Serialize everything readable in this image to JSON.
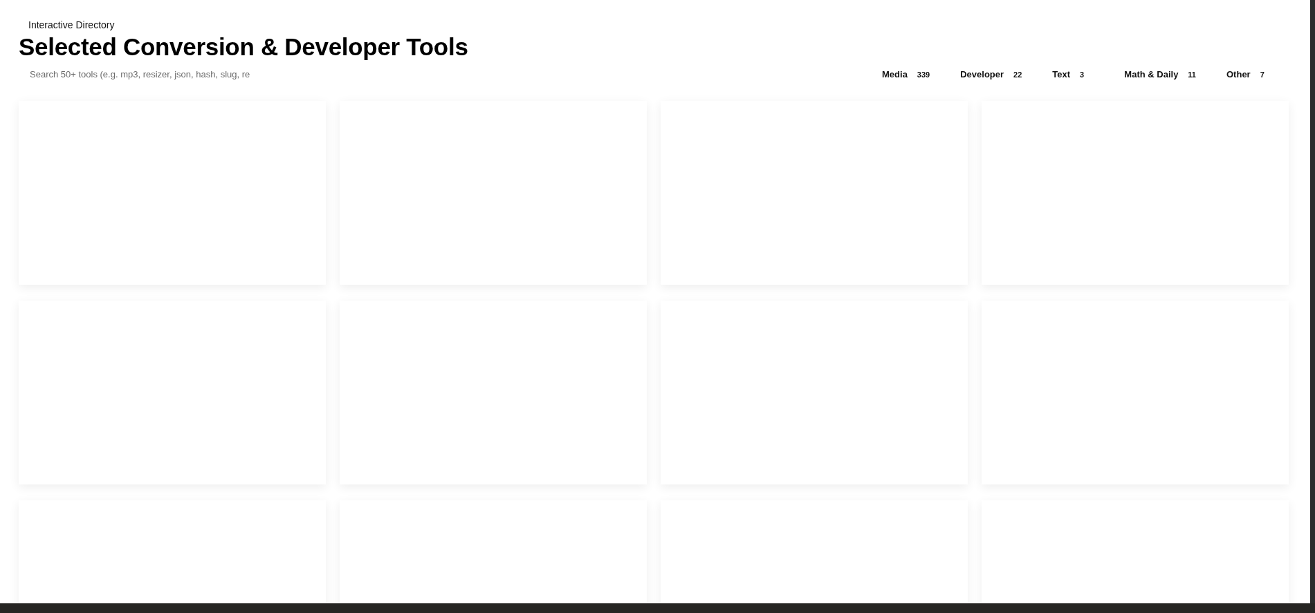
{
  "eyebrow": "Interactive Directory",
  "title": "Selected Conversion & Developer Tools",
  "search": {
    "placeholder": "Search 50+ tools (e.g. mp3, resizer, json, hash, slug, re"
  },
  "categories": [
    {
      "label": "Media",
      "count": "339"
    },
    {
      "label": "Developer",
      "count": "22"
    },
    {
      "label": "Text",
      "count": "3"
    },
    {
      "label": "Math & Daily",
      "count": "11"
    },
    {
      "label": "Other",
      "count": "7"
    }
  ],
  "cards": [
    {
      "kind": "blank"
    },
    {
      "kind": "blank"
    },
    {
      "kind": "blank"
    },
    {
      "kind": "blank"
    },
    {
      "kind": "blank"
    },
    {
      "kind": "blank"
    },
    {
      "kind": "blank"
    },
    {
      "kind": "blank"
    },
    {
      "kind": "blank"
    },
    {
      "kind": "blank"
    },
    {
      "kind": "blank"
    },
    {
      "kind": "blank"
    }
  ]
}
